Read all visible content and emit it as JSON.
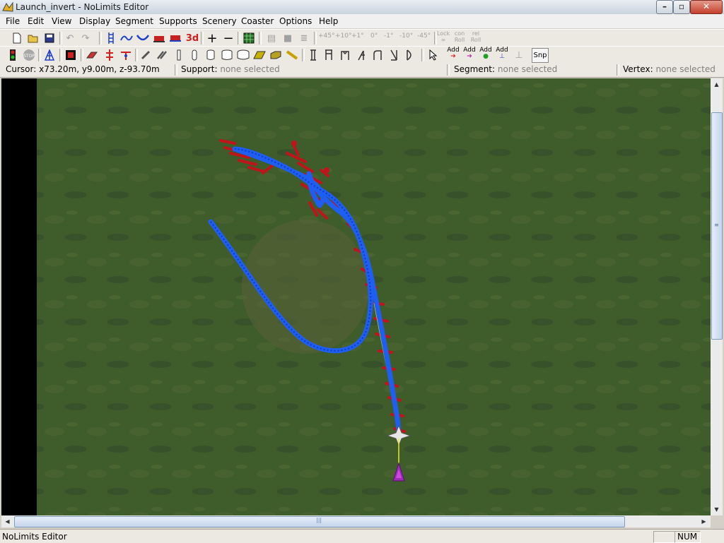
{
  "window": {
    "title": "Launch_invert - NoLimits Editor",
    "icon": "nolimits-app-icon",
    "buttons": [
      "minimize",
      "maximize",
      "close"
    ]
  },
  "menu": [
    "File",
    "Edit",
    "View",
    "Display",
    "Segment",
    "Supports",
    "Scenery",
    "Coaster",
    "Options",
    "Help"
  ],
  "toolbar1": {
    "text_3d": "3d",
    "angle_labels": [
      "+45°",
      "+10°",
      "+1°",
      "0°",
      "-1°",
      "-10°",
      "-45°"
    ],
    "lock_label": "Lock",
    "roll_labels": [
      "con Roll",
      "rel Roll"
    ]
  },
  "toolbar2": {
    "add_buttons": [
      "Add",
      "Add",
      "Add",
      "Add"
    ],
    "snap_label": "Snp"
  },
  "infobar": {
    "cursor_label": "Cursor:",
    "cursor_value": "x73.20m, y9.00m, z-93.70m",
    "support_label": "Support:",
    "support_value": "none selected",
    "segment_label": "Segment:",
    "segment_value": "none selected",
    "vertex_label": "Vertex:",
    "vertex_value": "none selected"
  },
  "colors": {
    "ground": "#3d5a2a",
    "track": "#1e5ef0",
    "supports": "#c0141a",
    "launch": "#e8e830",
    "station_marker": "#9a2fb5"
  },
  "statusbar": {
    "text": "NoLimits Editor",
    "num": "NUM"
  }
}
